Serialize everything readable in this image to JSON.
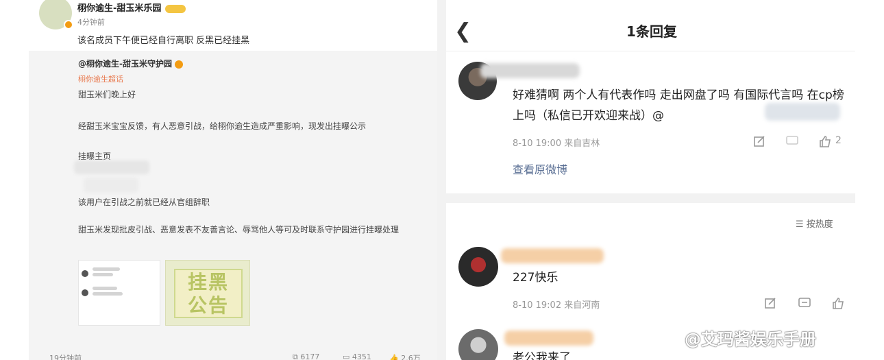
{
  "left": {
    "username": "栩你逾生-甜玉米乐园",
    "time": "4分钟前",
    "comment": "该名成员下午便已经自行离职 反黑已经挂黑",
    "quote": {
      "author": "@栩你逾生-甜玉米守护园",
      "tag": "栩你逾生超话",
      "line1": "甜玉米们晚上好",
      "line2": "经甜玉米宝宝反馈，有人恶意引战，给栩你逾生造成严重影响，现发出挂曝公示",
      "line3": "挂曝主页",
      "line4": "该用户在引战之前就已经从官组辞职",
      "line5": "甜玉米发现批皮引战、恶意发表不友善言论、辱骂他人等可及时联系守护园进行挂曝处理",
      "poster_text_1": "挂黑",
      "poster_text_2": "公告"
    },
    "footer": {
      "time": "19分钟前",
      "reposts": "6177",
      "comments": "4351",
      "likes": "2.6万"
    }
  },
  "right": {
    "title": "1条回复",
    "reply1": {
      "text": "好难猜啊 两个人有代表作吗 走出网盘了吗 有国际代言吗 在cp榜上吗（私信已开欢迎来战）@",
      "meta": "8-10 19:00  来自吉林",
      "like_count": "2",
      "link": "查看原微博"
    },
    "sort_label": "按热度",
    "reply2": {
      "text": "227快乐",
      "meta": "8-10 19:02  来自河南"
    },
    "reply3": {
      "text": "老公我来了"
    }
  },
  "watermark": "@艾玛酱娱乐手册",
  "colors": {
    "link": "#5a6f94",
    "badge": "#f39c12",
    "tag": "#e8764a"
  }
}
